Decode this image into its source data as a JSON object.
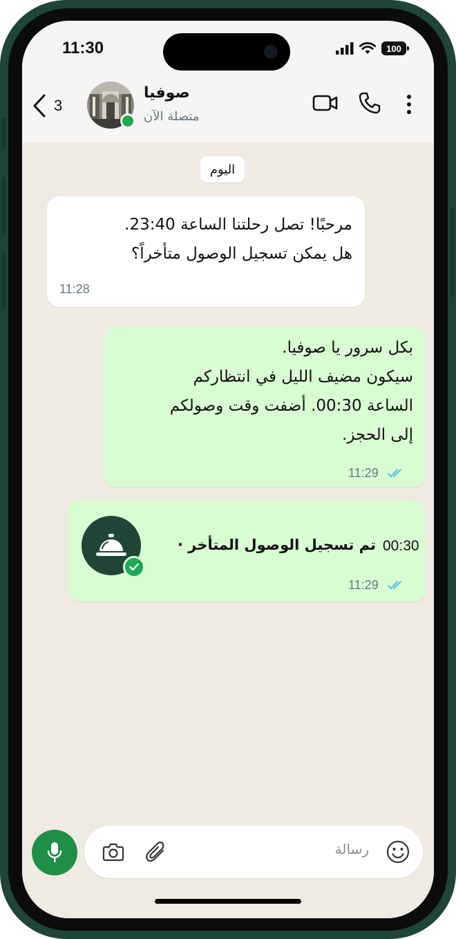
{
  "status_bar": {
    "time": "11:30",
    "battery": "100"
  },
  "header": {
    "back_count": "3",
    "contact_name": "صوفيا",
    "contact_status": "متصلة الآن",
    "icons": [
      "chevron-left-icon",
      "video-call-icon",
      "phone-icon",
      "more-vertical-icon"
    ]
  },
  "chat": {
    "day_label": "اليوم",
    "messages": [
      {
        "direction": "incoming",
        "text": "مرحبًا! تصل رحلتنا الساعة 23:40.\nهل يمكن تسجيل الوصول متأخراً؟",
        "time": "11:28"
      },
      {
        "direction": "outgoing",
        "text": "بكل سرور يا صوفيا.\nسيكون مضيف الليل في انتظاركم\nالساعة 00:30. أضفت وقت وصولكم\nإلى الحجز.",
        "time": "11:29",
        "status": "read"
      }
    ],
    "event": {
      "title": "تم تسجيل الوصول المتأخر ·",
      "event_time": "00:30",
      "time": "11:29",
      "icon": "service-bell-icon",
      "status": "read"
    }
  },
  "composer": {
    "placeholder": "رسالة",
    "icons": [
      "mic-icon",
      "camera-icon",
      "attachment-icon",
      "emoji-icon"
    ]
  },
  "colors": {
    "frame": "#1e4536",
    "outgoing_bubble": "#d9fdd3",
    "incoming_bubble": "#ffffff",
    "chat_background": "#efeae2",
    "online": "#1fa855",
    "mic_button": "#1f8f48",
    "read_ticks": "#53bdeb"
  }
}
